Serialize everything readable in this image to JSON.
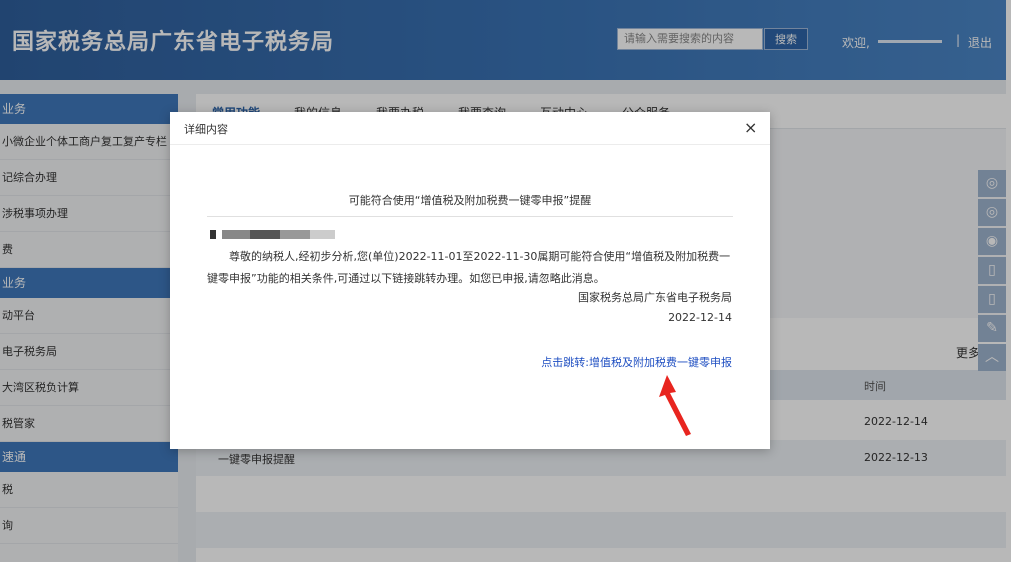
{
  "header": {
    "site_title": "国家税务总局广东省电子税务局",
    "search_placeholder": "请输入需要搜索的内容",
    "search_button": "搜索",
    "welcome": "欢迎,",
    "separator": "|",
    "logout": "退出"
  },
  "sidebar": {
    "sections": [
      {
        "heading": "业务",
        "items": [
          "小微企业个体工商户复工复产专栏",
          "记综合办理",
          "涉税事项办理",
          "费"
        ]
      },
      {
        "heading": "业务",
        "items": [
          "动平台",
          "电子税务局",
          "大湾区税负计算",
          "税管家"
        ]
      },
      {
        "heading": "速通",
        "items": [
          "税",
          "询"
        ]
      }
    ]
  },
  "main": {
    "tabs": [
      "常用功能",
      "我的信息",
      "我要办税",
      "我要查询",
      "互动中心",
      "公众服务"
    ],
    "more": "更多",
    "col_time": "时间",
    "rows": [
      {
        "title": "",
        "date": "2022-12-14"
      },
      {
        "title": "一键零申报提醒",
        "date": "2022-12-13"
      }
    ]
  },
  "modal": {
    "title": "详细内容",
    "close": "×",
    "notice_title": "可能符合使用“增值税及附加税费一键零申报”提醒",
    "body": "尊敬的纳税人,经初步分析,您(单位)2022-11-01至2022-11-30属期可能符合使用“增值税及附加税费一键零申报”功能的相关条件,可通过以下链接跳转办理。如您已申报,请忽略此消息。",
    "signer": "国家税务总局广东省电子税务局",
    "date": "2022-12-14",
    "jump_prefix": "点击跳转:",
    "jump_link": "增值税及附加税费一键零申报"
  },
  "float_icons": [
    "wechat-icon",
    "wechat-icon",
    "weibo-icon",
    "mobile-icon",
    "mobile-icon",
    "edit-icon",
    "chevron-up-icon"
  ],
  "colors": {
    "header_bg": "#3a73b5",
    "sidebar_heading_bg": "#3f78bb",
    "link": "#1f4fc2",
    "arrow": "#e8251f"
  }
}
